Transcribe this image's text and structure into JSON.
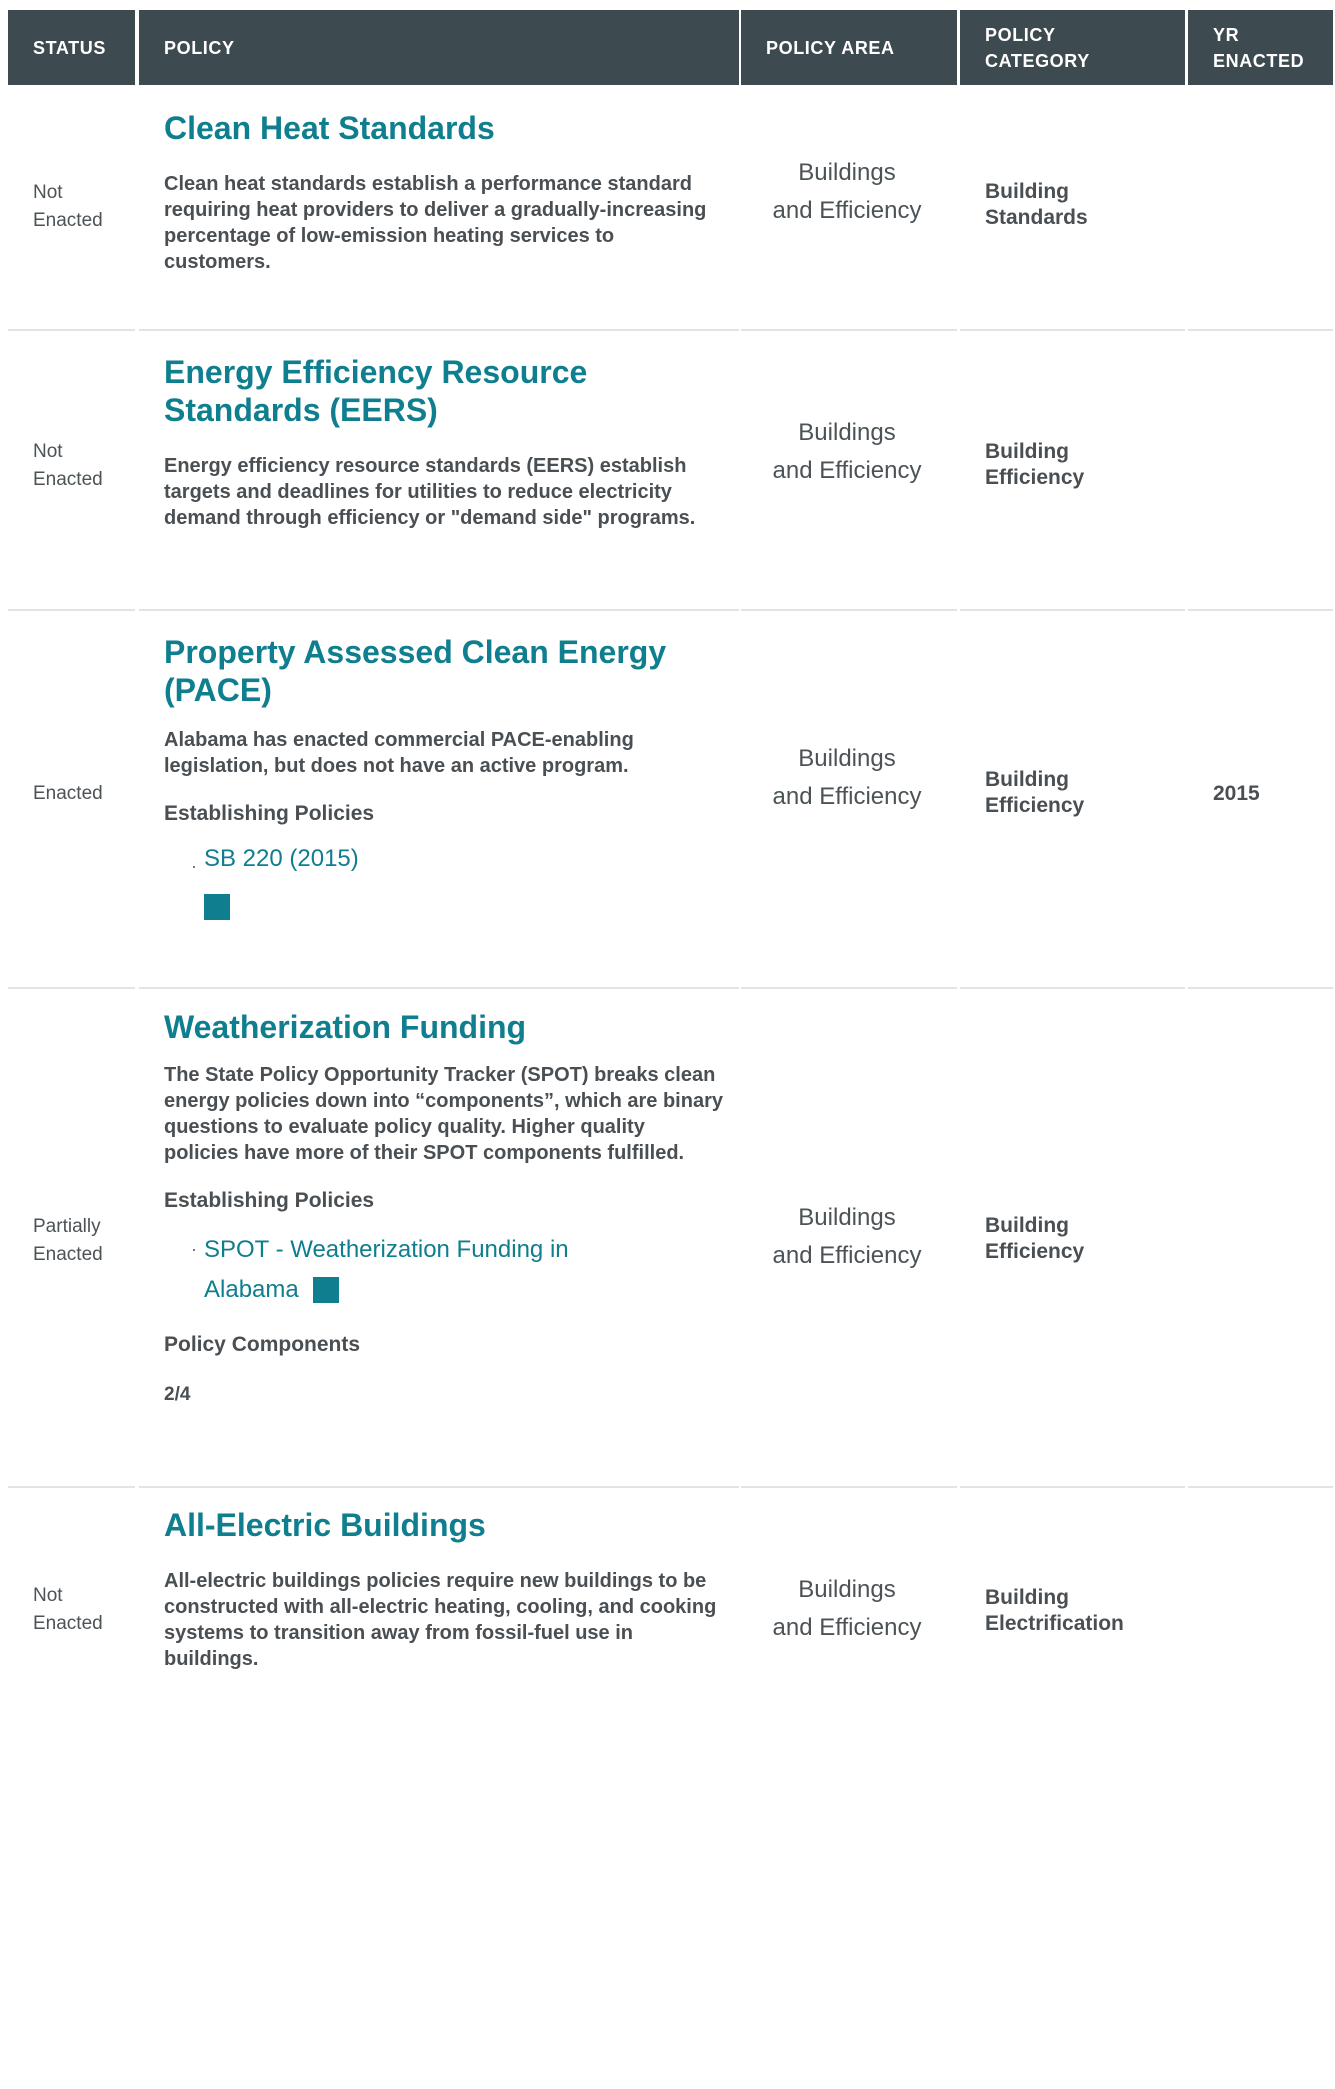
{
  "header": {
    "status": "STATUS",
    "policy": "POLICY",
    "policy_area": "POLICY AREA",
    "policy_category_1": "POLICY",
    "policy_category_2": "CATEGORY",
    "yr_enacted_1": "YR",
    "yr_enacted_2": "ENACTED"
  },
  "rows": [
    {
      "status_1": "Not",
      "status_2": "Enacted",
      "title": "Clean Heat Standards",
      "description": "Clean heat standards establish a performance standard requiring heat providers to deliver a gradually-increasing percentage of low-emission heating services to customers.",
      "area_1": "Buildings",
      "area_2": "and Efficiency",
      "category_1": "Building",
      "category_2": "Standards",
      "year": ""
    },
    {
      "status_1": "Not",
      "status_2": "Enacted",
      "title": "Energy Efficiency Resource Standards (EERS)",
      "description": "Energy efficiency resource standards (EERS) establish targets and deadlines for utilities to reduce electricity demand through efficiency or \"demand side\" programs.",
      "area_1": "Buildings",
      "area_2": "and Efficiency",
      "category_1": "Building",
      "category_2": "Efficiency",
      "year": ""
    },
    {
      "status_1": "Enacted",
      "status_2": "",
      "title": "Property Assessed Clean Energy (PACE)",
      "description": "Alabama has enacted commercial PACE-enabling legislation, but does not have an active program.",
      "establishing_label": "Establishing Policies",
      "links": [
        "SB 220 (2015)"
      ],
      "area_1": "Buildings",
      "area_2": "and Efficiency",
      "category_1": "Building",
      "category_2": "Efficiency",
      "year": "2015"
    },
    {
      "status_1": "Partially",
      "status_2": "Enacted",
      "title": "Weatherization Funding",
      "description": "The State Policy Opportunity Tracker (SPOT) breaks clean energy policies down into “components”, which are binary questions to evaluate policy quality. Higher quality policies have more of their SPOT components fulfilled.",
      "establishing_label": "Establishing Policies",
      "links": [
        "SPOT - Weatherization Funding in Alabama"
      ],
      "components_label": "Policy Components",
      "components_value": "2/4",
      "area_1": "Buildings",
      "area_2": "and Efficiency",
      "category_1": "Building",
      "category_2": "Efficiency",
      "year": ""
    },
    {
      "status_1": "Not",
      "status_2": "Enacted",
      "title": "All-Electric Buildings",
      "description": "All-electric buildings policies require new buildings to be constructed with all-electric heating, cooling, and cooking systems to transition away from fossil-fuel use in buildings.",
      "area_1": "Buildings",
      "area_2": "and Efficiency",
      "category_1": "Building",
      "category_2": "Electrification",
      "year": ""
    }
  ],
  "colors": {
    "header_bg": "#3d4a50",
    "accent": "#0f7e8e",
    "text": "#4a4f53",
    "divider": "#e2e4e4"
  },
  "icons": [
    "external-link-square-icon"
  ]
}
